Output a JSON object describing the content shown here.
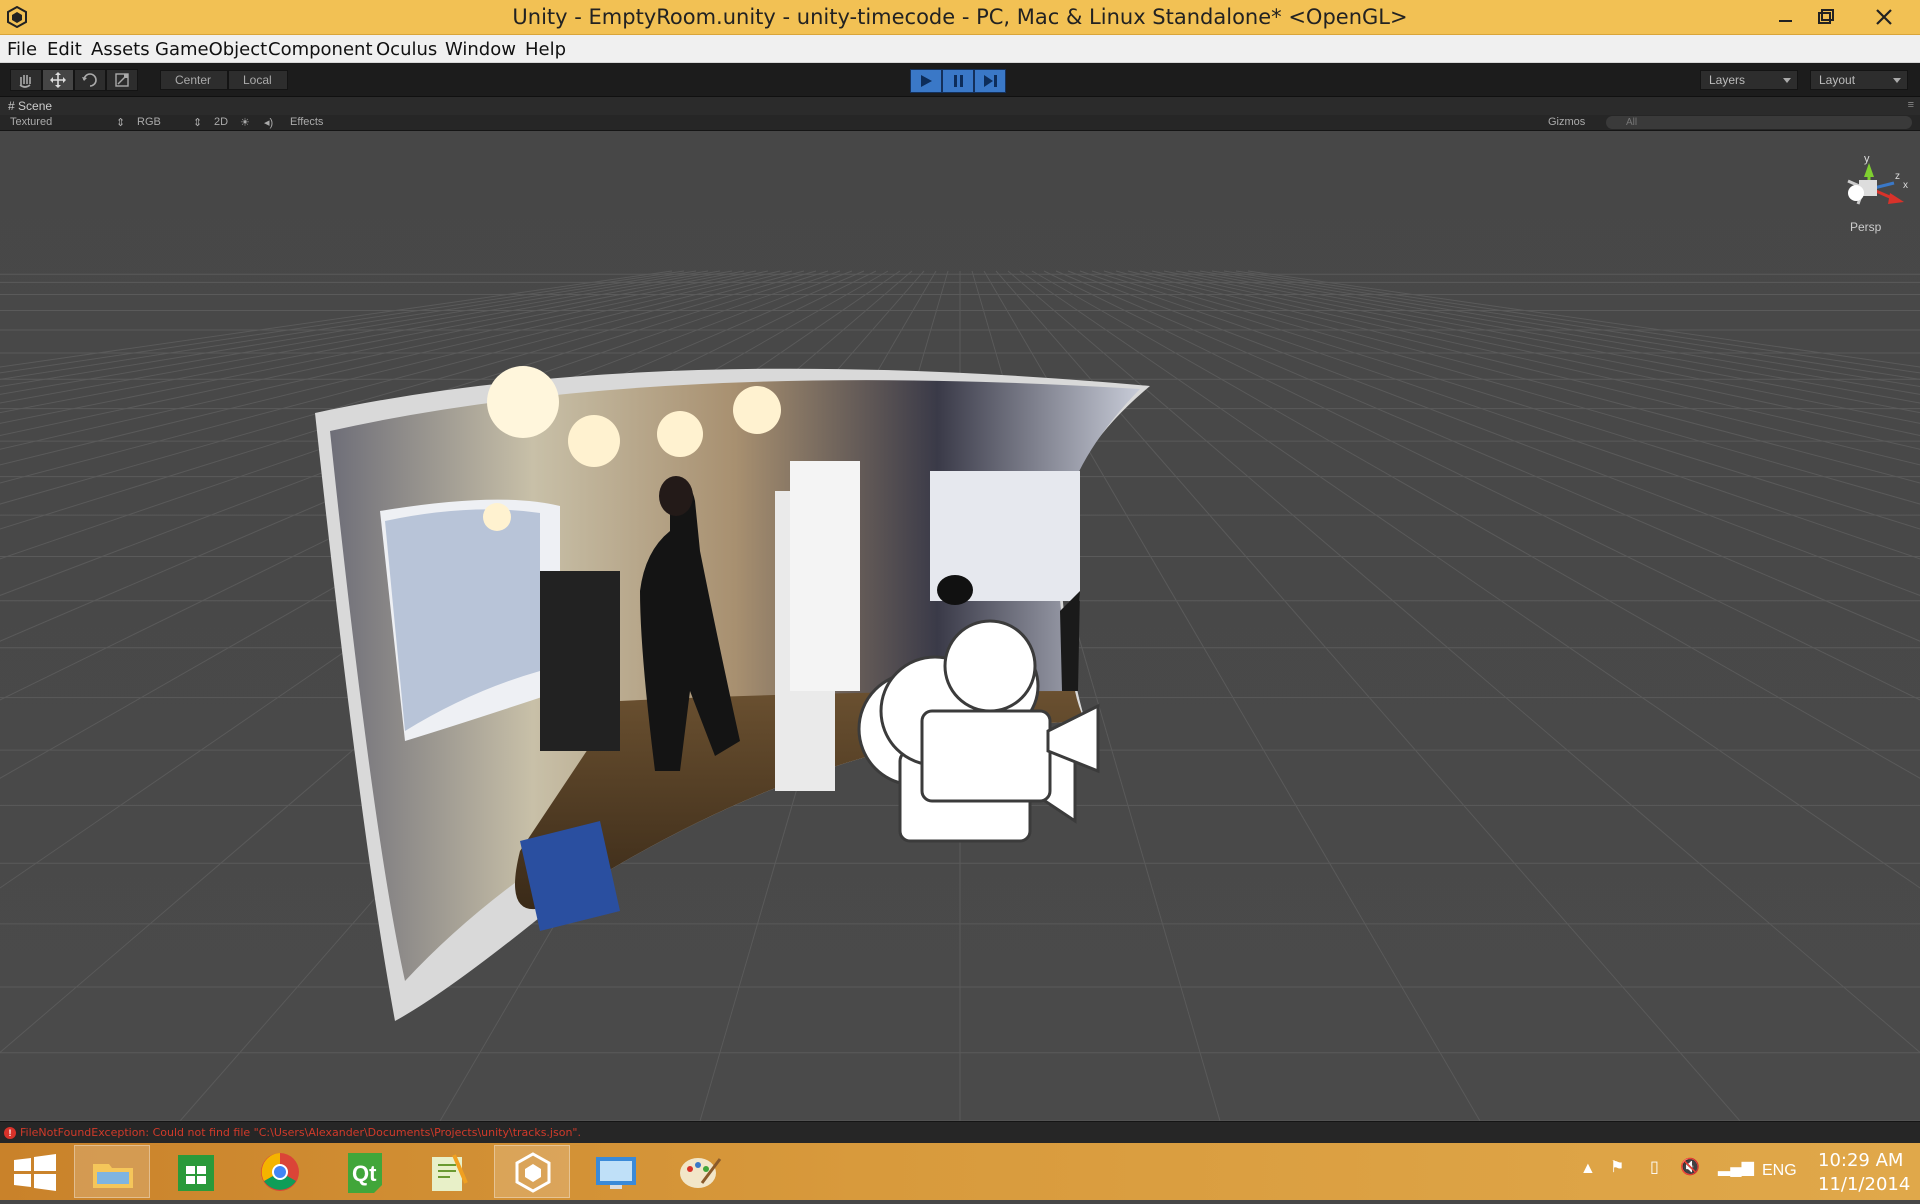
{
  "window": {
    "title": "Unity - EmptyRoom.unity - unity-timecode - PC, Mac & Linux Standalone* <OpenGL>",
    "icons": [
      "unity-logo-icon",
      "minimize-icon",
      "restore-icon",
      "close-icon"
    ]
  },
  "menu": [
    "File",
    "Edit",
    "Assets",
    "GameObject",
    "Component",
    "Oculus",
    "Window",
    "Help"
  ],
  "toolbar": {
    "tools": [
      "hand-tool-icon",
      "move-tool-icon",
      "rotate-tool-icon",
      "scale-tool-icon"
    ],
    "pivot_mode": "Center",
    "pivot_space": "Local",
    "playback": [
      "play-icon",
      "pause-icon",
      "step-icon"
    ],
    "layers_label": "Layers",
    "layout_label": "Layout"
  },
  "scene": {
    "tab_label": "Scene",
    "draw_mode": "Textured",
    "render_mode": "RGB",
    "mode_2d": "2D",
    "effects_label": "Effects",
    "gizmos_label": "Gizmos",
    "search_placeholder": "All",
    "gizmo_axes": {
      "y": "y",
      "z": "z",
      "x": "x"
    },
    "projection_label": "Persp",
    "accent_color": "#3a78c7"
  },
  "console": {
    "message": "FileNotFoundException: Could not find file \"C:\\Users\\Alexander\\Documents\\Projects\\unity\\tracks.json\".",
    "color": "#d03a2a"
  },
  "taskbar": {
    "apps": [
      "windows-start-icon",
      "file-explorer-icon",
      "windows-store-icon",
      "chrome-icon",
      "qt-creator-icon",
      "notepad-plus-plus-icon",
      "unity-icon",
      "remote-desktop-icon",
      "paint-icon"
    ],
    "tray": [
      "show-hidden-icons",
      "action-center-flag-icon",
      "battery-icon",
      "volume-muted-icon",
      "network-icon"
    ],
    "language": "ENG",
    "time": "10:29 AM",
    "date": "11/1/2014"
  }
}
